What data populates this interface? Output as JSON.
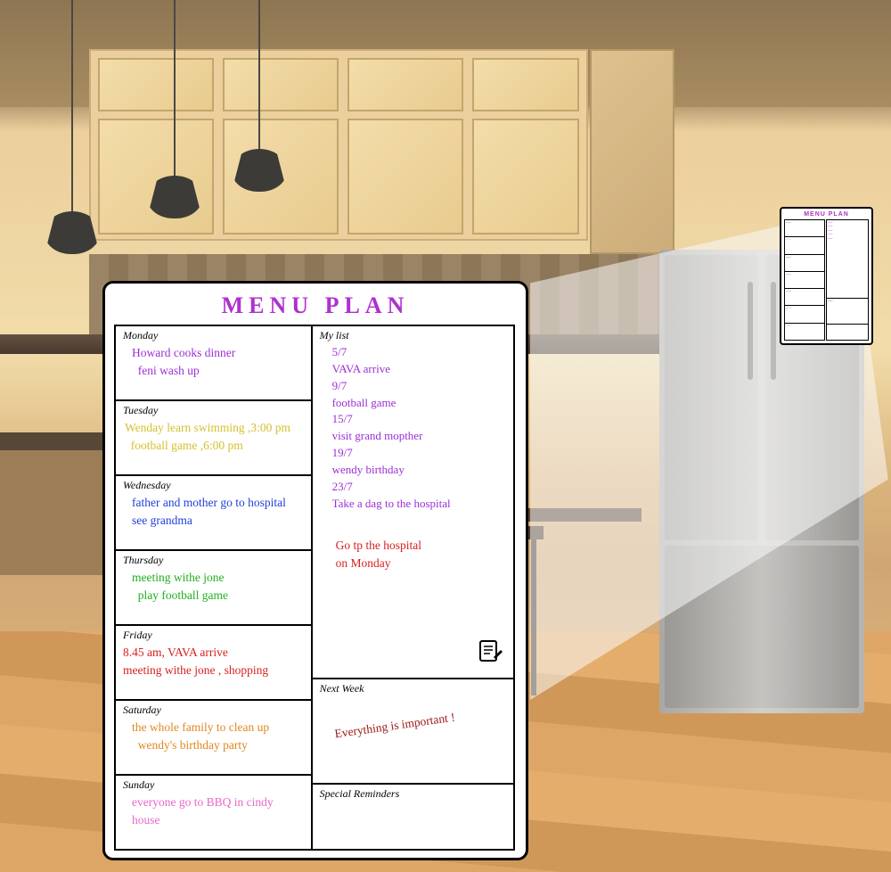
{
  "title": "MENU PLAN",
  "days": {
    "monday": {
      "label": "Monday",
      "line1": "Howard cooks dinner",
      "line2": "feni wash up",
      "color1": "txt-purple",
      "color2": "txt-purple"
    },
    "tuesday": {
      "label": "Tuesday",
      "line1": "Wenday learn swimming ,3:00 pm",
      "line2": "football game ,6:00 pm",
      "color1": "txt-yellow",
      "color2": "txt-yellow"
    },
    "wednesday": {
      "label": "Wednesday",
      "line1": "father and mother go to hospital",
      "line2": "see grandma",
      "color1": "txt-blue",
      "color2": "txt-blue"
    },
    "thursday": {
      "label": "Thursday",
      "line1": "meeting withe jone",
      "line2": "play football game",
      "color1": "txt-green",
      "color2": "txt-green"
    },
    "friday": {
      "label": "Friday",
      "line1": "8.45 am, VAVA arrive",
      "line2": "meeting withe jone ,  shopping",
      "color1": "txt-red",
      "color2": "txt-red"
    },
    "saturday": {
      "label": "Saturday",
      "line1": "the whole family to clean up",
      "line2": "wendy's birthday party",
      "color1": "txt-orange",
      "color2": "txt-orange"
    },
    "sunday": {
      "label": "Sunday",
      "line1": "everyone go to  BBQ  in cindy",
      "line2": "house",
      "color1": "txt-pink",
      "color2": "txt-pink"
    }
  },
  "mylist": {
    "label": "My list",
    "items": "5/7\nVAVA  arrive\n9/7\nfootball  game\n15/7\nvisit grand mopther\n19/7\nwendy birthday\n23/7\nTake a dag to the hospital",
    "note": "Go tp the hospital\non Monday",
    "items_color": "txt-purple",
    "note_color": "txt-red"
  },
  "nextweek": {
    "label": "Next Week",
    "text": "Everything is important !",
    "color": "txt-darkred"
  },
  "special": {
    "label": "Special   Reminders"
  },
  "icons": {
    "notepad": "📋"
  }
}
